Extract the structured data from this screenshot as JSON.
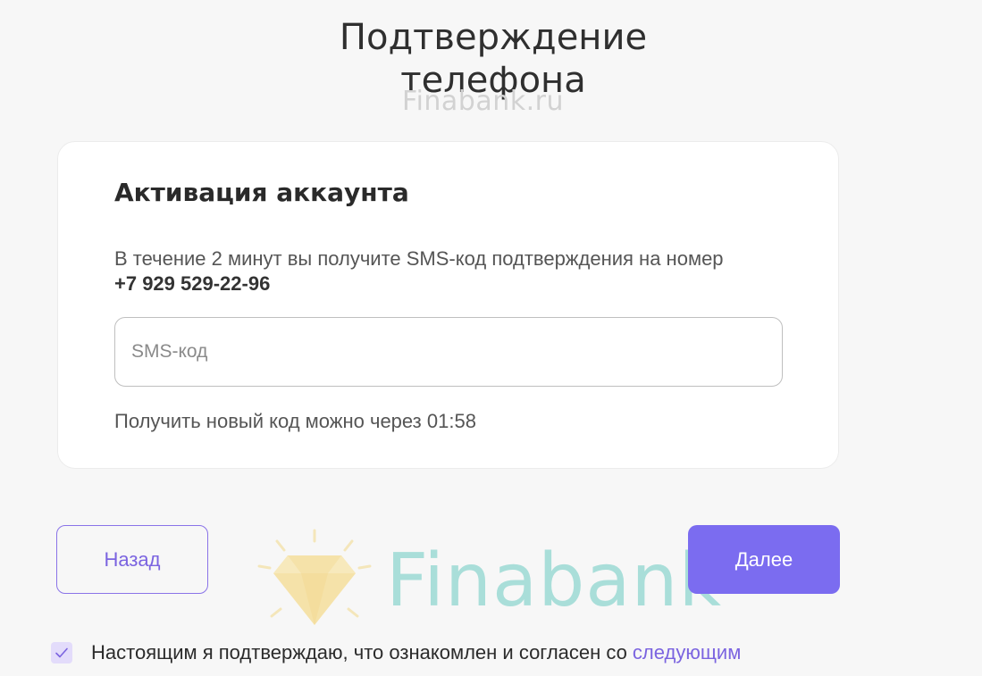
{
  "page": {
    "title_line1": "Подтверждение",
    "title_line2": "телефона",
    "watermark_top": "Finabank.ru",
    "watermark_brand": "Finabank"
  },
  "card": {
    "title": "Активация аккаунта",
    "description": "В течение 2 минут вы получите SMS-код подтверждения на номер",
    "phone": "+7 929 529-22-96",
    "sms_input": {
      "placeholder": "SMS-код",
      "value": ""
    },
    "resend_text": "Получить новый код можно через 01:58"
  },
  "actions": {
    "back_label": "Назад",
    "next_label": "Далее"
  },
  "consent": {
    "checked": true,
    "text": "Настоящим я подтверждаю, что ознакомлен и согласен со",
    "link_text": "следующим"
  },
  "colors": {
    "accent": "#7b6cf0",
    "accent_text": "#7b64e0",
    "background": "#f7f7f7",
    "card": "#ffffff"
  },
  "icons": {
    "checkbox": "check-icon",
    "watermark_logo": "diamond-logo-icon"
  }
}
